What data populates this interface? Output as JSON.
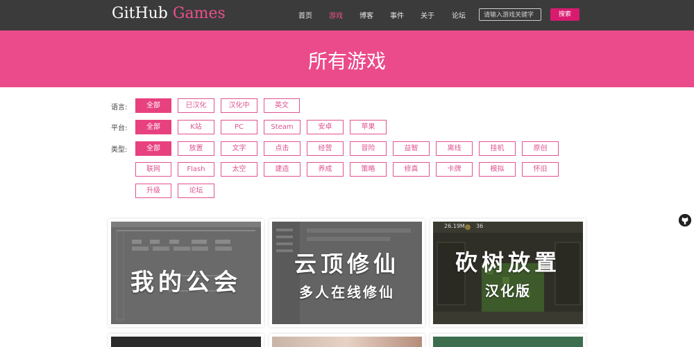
{
  "header": {
    "logo_main": "GitHub ",
    "logo_accent": "Games",
    "nav": [
      "首页",
      "游戏",
      "博客",
      "事件",
      "关于",
      "论坛"
    ],
    "active_nav": "游戏",
    "search_placeholder": "请输入游戏关键字",
    "search_button": "搜索"
  },
  "banner": {
    "title": "所有游戏"
  },
  "filters": {
    "language": {
      "label": "语言:",
      "options": [
        "全部",
        "已汉化",
        "汉化中",
        "英文"
      ],
      "selected": "全部"
    },
    "platform": {
      "label": "平台:",
      "options": [
        "全部",
        "K站",
        "PC",
        "Steam",
        "安卓",
        "苹果"
      ],
      "selected": "全部"
    },
    "type": {
      "label": "类型:",
      "options": [
        "全部",
        "放置",
        "文字",
        "点击",
        "经营",
        "冒险",
        "益智",
        "离线",
        "挂机",
        "原创",
        "联网",
        "Flash",
        "太空",
        "建造",
        "养成",
        "策略",
        "修真",
        "卡牌",
        "模拟",
        "怀旧",
        "升级",
        "论坛"
      ],
      "selected": "全部"
    }
  },
  "games": [
    {
      "title": "我的公会",
      "subtitle": ""
    },
    {
      "title": "云顶修仙",
      "subtitle": "多人在线修仙"
    },
    {
      "title": "砍树放置",
      "subtitle": "汉化版",
      "hud_left": "26.19M",
      "hud_right": "36"
    }
  ],
  "colors": {
    "accent": "#eb4b8a",
    "header_bg": "#3b3b3b",
    "tag_border": "#e05290",
    "search_button": "#d81b6f"
  },
  "side_icon": "github-icon"
}
